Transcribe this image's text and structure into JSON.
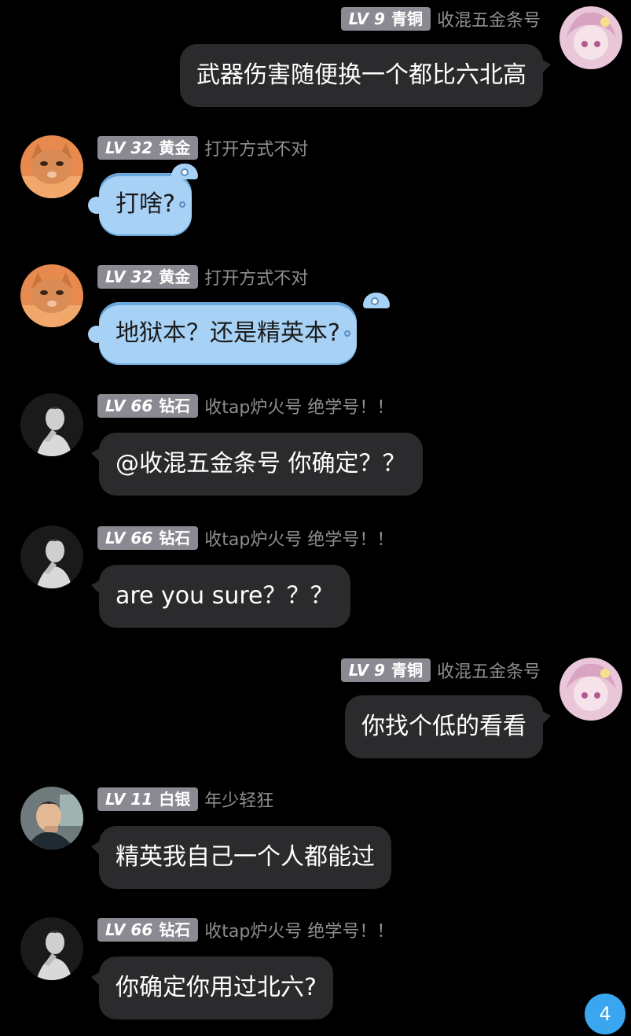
{
  "messages": [
    {
      "side": "right",
      "level": "LV 9",
      "tier": "青铜",
      "username": "收混五金条号",
      "text": "武器伤害随便换一个都比六北高",
      "avatar": "anime-avatar"
    },
    {
      "side": "left",
      "level": "LV 32",
      "tier": "黄金",
      "username": "打开方式不对",
      "text": "打啥?",
      "avatar": "cat-avatar",
      "bubble_style": "fish"
    },
    {
      "side": "left",
      "level": "LV 32",
      "tier": "黄金",
      "username": "打开方式不对",
      "text": "地狱本？还是精英本?",
      "avatar": "cat-avatar",
      "bubble_style": "fish"
    },
    {
      "side": "left",
      "level": "LV 66",
      "tier": "钻石",
      "username": "收tap炉火号 绝学号！！",
      "text": "@收混五金条号 你确定？？",
      "avatar": "man-bw-avatar"
    },
    {
      "side": "left",
      "level": "LV 66",
      "tier": "钻石",
      "username": "收tap炉火号 绝学号！！",
      "text": "are you sure？？？",
      "avatar": "man-bw-avatar"
    },
    {
      "side": "right",
      "level": "LV 9",
      "tier": "青铜",
      "username": "收混五金条号",
      "text": "你找个低的看看",
      "avatar": "anime-avatar"
    },
    {
      "side": "left",
      "level": "LV 11",
      "tier": "白银",
      "username": "年少轻狂",
      "text": "精英我自己一个人都能过",
      "avatar": "man-photo-avatar"
    },
    {
      "side": "left",
      "level": "LV 66",
      "tier": "钻石",
      "username": "收tap炉火号 绝学号！！",
      "text": "你确定你用过北六?",
      "avatar": "man-bw-avatar"
    }
  ],
  "unread_count": "4",
  "colors": {
    "background": "#000000",
    "bubble": "#2b2b2d",
    "special_bubble": "#a7d2f5",
    "badge": "#8a8a92",
    "unread": "#3aa6f0"
  }
}
